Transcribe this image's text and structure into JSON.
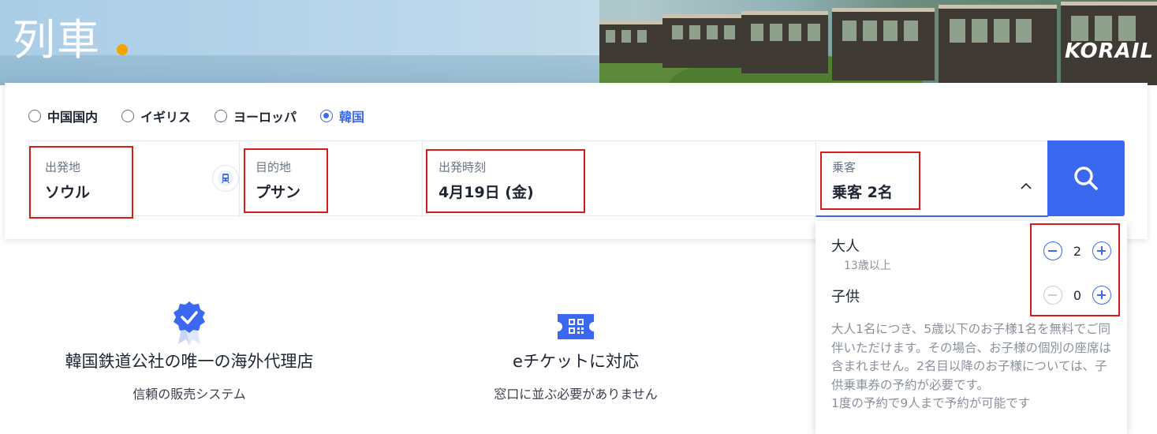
{
  "hero": {
    "title": "列車",
    "brand": "KORAIL"
  },
  "region_tabs": [
    {
      "label": "中国国内",
      "selected": false
    },
    {
      "label": "イギリス",
      "selected": false
    },
    {
      "label": "ヨーロッパ",
      "selected": false
    },
    {
      "label": "韓国",
      "selected": true
    }
  ],
  "search": {
    "from": {
      "label": "出発地",
      "value": "ソウル"
    },
    "to": {
      "label": "目的地",
      "value": "プサン"
    },
    "date": {
      "label": "出発時刻",
      "value": "4月19日 (金)"
    },
    "passengers": {
      "label": "乗客",
      "value": "乗客 2名"
    }
  },
  "passenger_dropdown": {
    "adult": {
      "label": "大人",
      "sub": "13歳以上",
      "count": "2"
    },
    "child": {
      "label": "子供",
      "count": "0"
    },
    "note": "大人1名につき、5歳以下のお子様1名を無料でご同伴いただけます。その場合、お子様の個別の座席は含まれません。2名目以降のお子様については、子供乗車券の予約が必要です。",
    "limit": "1度の予約で9人まで予約が可能です"
  },
  "features": [
    {
      "title": "韓国鉄道公社の唯一の海外代理店",
      "subtitle": "信頼の販売システム"
    },
    {
      "title": "eチケットに対応",
      "subtitle": "窓口に並ぶ必要がありません"
    }
  ],
  "colors": {
    "accent": "#3b68f0",
    "annotation": "#d61b1b",
    "brand_dot": "#f5a300"
  }
}
